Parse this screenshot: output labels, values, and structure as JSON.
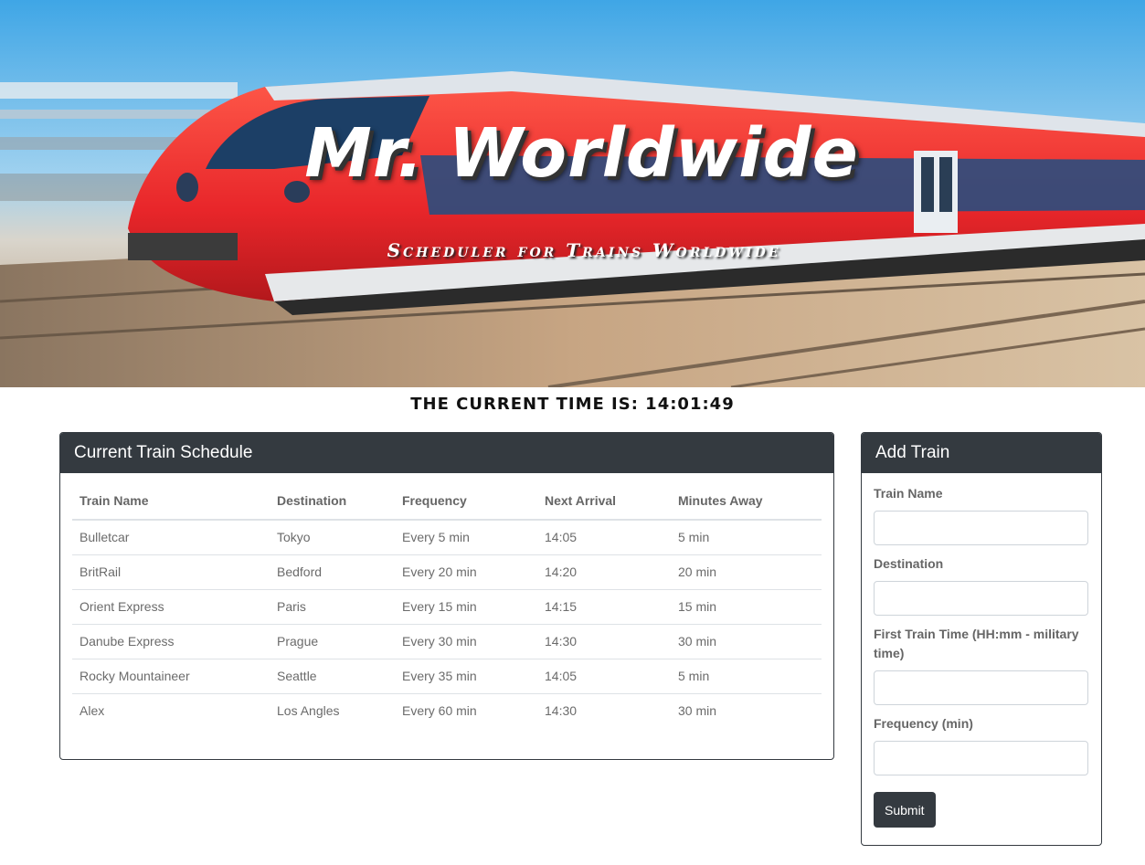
{
  "hero": {
    "title": "Mr. Worldwide",
    "subtitle": "Scheduler for Trains Worldwide"
  },
  "clock": {
    "label": "THE CURRENT TIME IS: 14:01:49"
  },
  "schedule": {
    "title": "Current Train Schedule",
    "columns": [
      "Train Name",
      "Destination",
      "Frequency",
      "Next Arrival",
      "Minutes Away"
    ],
    "rows": [
      [
        "Bulletcar",
        "Tokyo",
        "Every 5 min",
        "14:05",
        "5 min"
      ],
      [
        "BritRail",
        "Bedford",
        "Every 20 min",
        "14:20",
        "20 min"
      ],
      [
        "Orient Express",
        "Paris",
        "Every 15 min",
        "14:15",
        "15 min"
      ],
      [
        "Danube Express",
        "Prague",
        "Every 30 min",
        "14:30",
        "30 min"
      ],
      [
        "Rocky Mountaineer",
        "Seattle",
        "Every 35 min",
        "14:05",
        "5 min"
      ],
      [
        "Alex",
        "Los Angles",
        "Every 60 min",
        "14:30",
        "30 min"
      ]
    ]
  },
  "add_train": {
    "title": "Add Train",
    "fields": [
      {
        "label": "Train Name",
        "value": ""
      },
      {
        "label": "Destination",
        "value": ""
      },
      {
        "label": "First Train Time (HH:mm - military time)",
        "value": ""
      },
      {
        "label": "Frequency (min)",
        "value": ""
      }
    ],
    "submit_label": "Submit"
  },
  "colors": {
    "dark": "#343a40",
    "train_red": "#e8332a"
  }
}
